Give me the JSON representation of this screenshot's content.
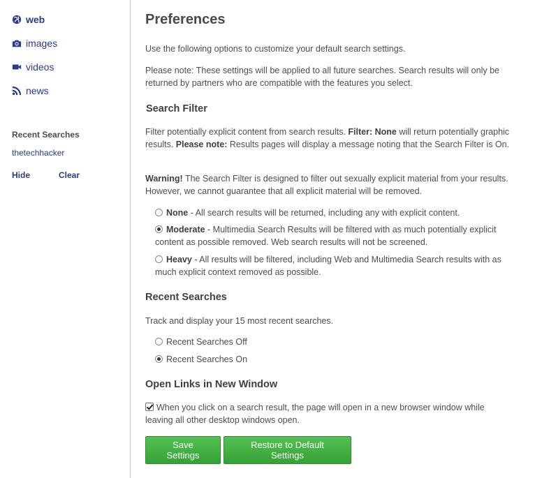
{
  "sidebar": {
    "nav": [
      {
        "label": "web",
        "icon": "globe-icon",
        "active": true
      },
      {
        "label": "images",
        "icon": "camera-icon",
        "active": false
      },
      {
        "label": "videos",
        "icon": "video-camera-icon",
        "active": false
      },
      {
        "label": "news",
        "icon": "rss-icon",
        "active": false
      }
    ],
    "recent_title": "Recent Searches",
    "recent_items": [
      "thetechhacker"
    ],
    "hide_label": "Hide",
    "clear_label": "Clear"
  },
  "main": {
    "title": "Preferences",
    "intro": "Use the following options to customize your default search settings.",
    "note": "Please note: These settings will be applied to all future searches. Search results will only be returned by partners who are compatible with the features you select.",
    "search_filter": {
      "heading": "Search Filter",
      "desc_1": "Filter potentially explicit content from search results. ",
      "desc_b1": "Filter: None",
      "desc_2": " will return potentially graphic results. ",
      "desc_b2": "Please note:",
      "desc_3": " Results pages will display a message noting that the Search Filter is On.",
      "warning_b": "Warning!",
      "warning": " The Search Filter is designed to filter out sexually explicit material from your results. However, we cannot guarantee that all explicit material will be removed.",
      "options": [
        {
          "label": "None",
          "desc": " - All search results will be returned, including any with explicit content.",
          "selected": false
        },
        {
          "label": "Moderate",
          "desc": " - Multimedia Search Results will be filtered with as much potentially explicit content as possible removed. Web search results will not be screened.",
          "selected": true
        },
        {
          "label": "Heavy",
          "desc": " - All results will be filtered, including Web and Multimedia Search results with as much explicit context removed as possible.",
          "selected": false
        }
      ]
    },
    "recent_searches": {
      "heading": "Recent Searches",
      "desc": "Track and display your 15 most recent searches.",
      "options": [
        {
          "label": "Recent Searches Off",
          "selected": false
        },
        {
          "label": "Recent Searches On",
          "selected": true
        }
      ]
    },
    "new_window": {
      "heading": "Open Links in New Window",
      "checkbox_label": "When you click on a search result, the page will open in a new browser window while leaving all other desktop windows open.",
      "checked": true
    },
    "save_label": "Save Settings",
    "restore_label": "Restore to Default Settings"
  },
  "colors": {
    "link": "#2b3a8c",
    "button_green": "#3fae3f"
  }
}
